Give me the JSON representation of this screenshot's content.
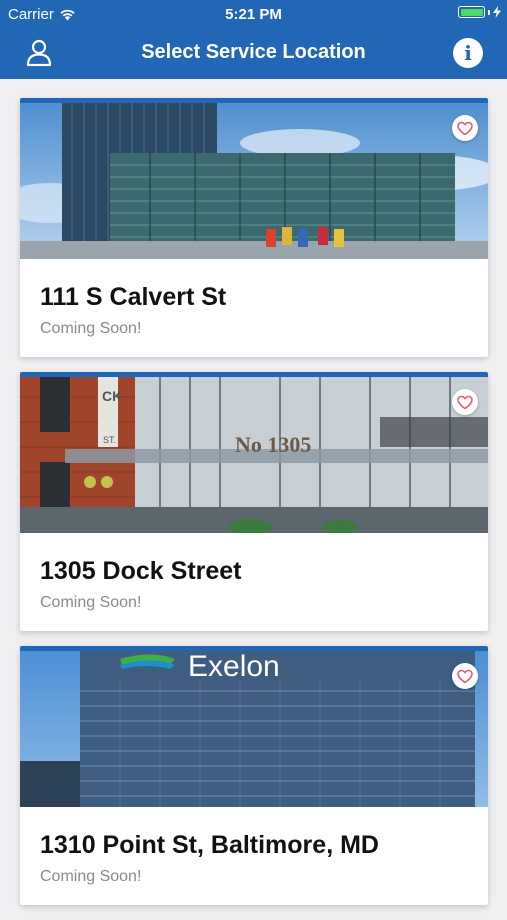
{
  "status": {
    "carrier": "Carrier",
    "time": "5:21 PM"
  },
  "nav": {
    "title": "Select Service Location",
    "left_icon": "user-icon",
    "right_icon": "info-icon",
    "info_glyph": "i"
  },
  "colors": {
    "primary": "#2266b6",
    "heart": "#e8577a",
    "battery": "#4cd964"
  },
  "locations": [
    {
      "name": "111 S Calvert St",
      "status": "Coming Soon!"
    },
    {
      "name": "1305 Dock Street",
      "status": "Coming Soon!"
    },
    {
      "name": "1310 Point St, Baltimore, MD",
      "status": "Coming Soon!"
    }
  ],
  "photos": {
    "dock_sign_1": "CK",
    "dock_sign_2": "ST.",
    "dock_sign_3": "No 1305",
    "exelon_sign": "Exelon"
  }
}
